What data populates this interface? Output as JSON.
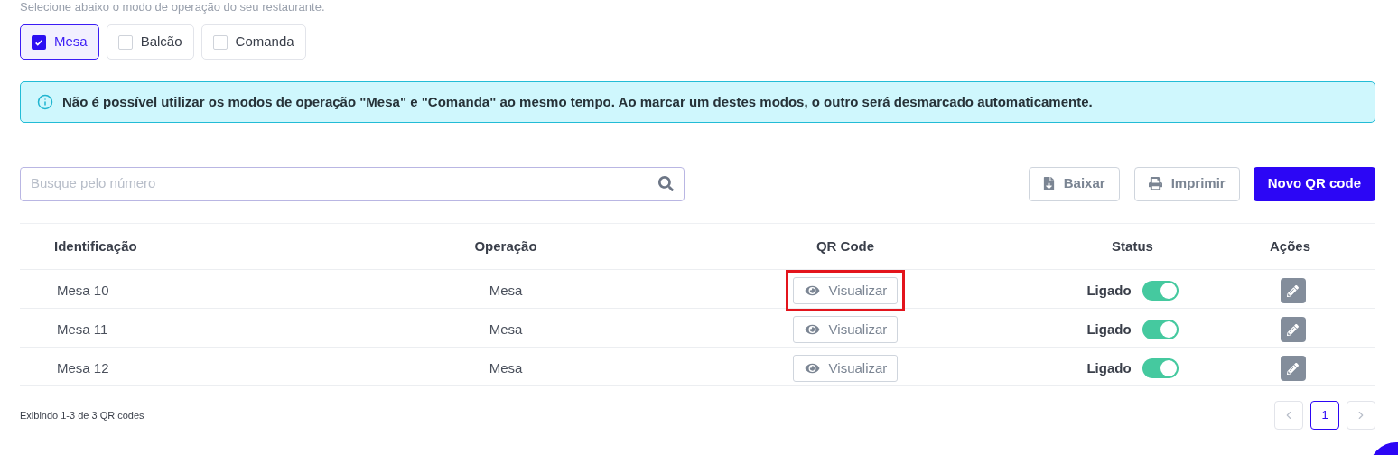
{
  "subtitle": "Selecione abaixo o modo de operação do seu restaurante.",
  "modes": [
    {
      "label": "Mesa",
      "checked": true
    },
    {
      "label": "Balcão",
      "checked": false
    },
    {
      "label": "Comanda",
      "checked": false
    }
  ],
  "alert": "Não é possível utilizar os modos de operação \"Mesa\" e \"Comanda\" ao mesmo tempo. Ao marcar um destes modos, o outro será desmarcado automaticamente.",
  "search": {
    "placeholder": "Busque pelo número"
  },
  "actions": {
    "download": "Baixar",
    "print": "Imprimir",
    "new": "Novo QR code"
  },
  "table": {
    "columns": [
      "Identificação",
      "Operação",
      "QR Code",
      "Status",
      "Ações"
    ],
    "rows": [
      {
        "id": "Mesa 10",
        "operation": "Mesa",
        "qr_button": "Visualizar",
        "highlighted": true,
        "status": "Ligado",
        "on": true
      },
      {
        "id": "Mesa 11",
        "operation": "Mesa",
        "qr_button": "Visualizar",
        "highlighted": false,
        "status": "Ligado",
        "on": true
      },
      {
        "id": "Mesa 12",
        "operation": "Mesa",
        "qr_button": "Visualizar",
        "highlighted": false,
        "status": "Ligado",
        "on": true
      }
    ]
  },
  "footer": {
    "summary": "Exibindo 1-3 de 3 QR codes",
    "pages": [
      {
        "label": "1",
        "selected": true
      }
    ]
  }
}
